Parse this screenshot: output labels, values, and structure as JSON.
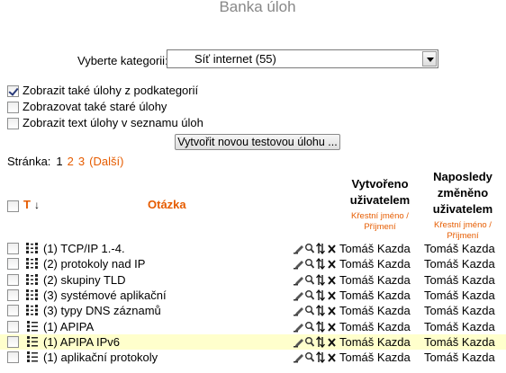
{
  "page": {
    "title": "Banka úloh"
  },
  "category": {
    "label": "Vyberte kategorii:",
    "selected": "Síť internet (55)"
  },
  "options": [
    {
      "label": "Zobrazit také úlohy z podkategorií",
      "checked": true
    },
    {
      "label": "Zobrazovat také staré úlohy",
      "checked": false
    },
    {
      "label": "Zobrazit text úlohy v seznamu úloh",
      "checked": false
    }
  ],
  "new_button": {
    "label": "Vytvořit novou testovou úlohu ..."
  },
  "pager": {
    "label": "Stránka:",
    "current": "1",
    "pages": [
      "2",
      "3"
    ],
    "next": "(Další)"
  },
  "table": {
    "headers": {
      "type": "T",
      "question": "Otázka",
      "created": "Vytvořeno uživatelem",
      "created_sub": "Křestní jméno / Příjmení",
      "modified": "Naposledy změněno uživatelem",
      "modified_sub": "Křestní jméno / Příjmení"
    },
    "rows": [
      {
        "type_icon": "matching-icon",
        "question": "(1) TCP/IP 1.-4.",
        "created": "Tomáš Kazda",
        "modified": "Tomáš Kazda",
        "highlight": false
      },
      {
        "type_icon": "matching-icon",
        "question": "(2) protokoly nad IP",
        "created": "Tomáš Kazda",
        "modified": "Tomáš Kazda",
        "highlight": false
      },
      {
        "type_icon": "matching-icon",
        "question": "(2) skupiny TLD",
        "created": "Tomáš Kazda",
        "modified": "Tomáš Kazda",
        "highlight": false
      },
      {
        "type_icon": "matching-icon",
        "question": "(3) systémové aplikační",
        "created": "Tomáš Kazda",
        "modified": "Tomáš Kazda",
        "highlight": false
      },
      {
        "type_icon": "matching-icon",
        "question": "(3) typy DNS záznamů",
        "created": "Tomáš Kazda",
        "modified": "Tomáš Kazda",
        "highlight": false
      },
      {
        "type_icon": "multichoice-icon",
        "question": "(1) APIPA",
        "created": "Tomáš Kazda",
        "modified": "Tomáš Kazda",
        "highlight": false
      },
      {
        "type_icon": "multichoice-icon",
        "question": "(1) APIPA IPv6",
        "created": "Tomáš Kazda",
        "modified": "Tomáš Kazda",
        "highlight": true
      },
      {
        "type_icon": "multichoice-icon",
        "question": "(1) aplikační protokoly",
        "created": "Tomáš Kazda",
        "modified": "Tomáš Kazda",
        "highlight": false
      }
    ]
  },
  "colors": {
    "accent": "#e65c00",
    "highlight": "#ffffcc",
    "title": "#888888"
  }
}
